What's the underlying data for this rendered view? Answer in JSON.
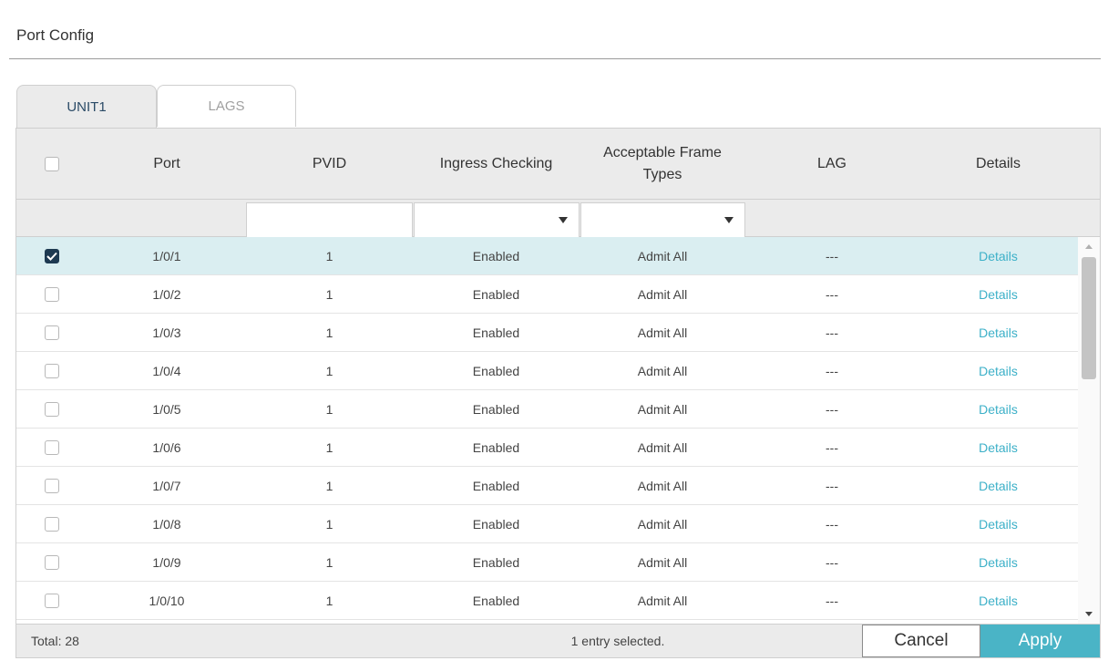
{
  "section": {
    "title": "Port Config"
  },
  "tabs": [
    {
      "label": "UNIT1",
      "active": true
    },
    {
      "label": "LAGS",
      "active": false
    }
  ],
  "columns": {
    "port": "Port",
    "pvid": "PVID",
    "ingress": "Ingress Checking",
    "frame_types": "Acceptable Frame Types",
    "lag": "LAG",
    "details": "Details"
  },
  "rows": [
    {
      "checked": true,
      "port": "1/0/1",
      "pvid": "1",
      "ingress": "Enabled",
      "frame_types": "Admit All",
      "lag": "---",
      "details": "Details"
    },
    {
      "checked": false,
      "port": "1/0/2",
      "pvid": "1",
      "ingress": "Enabled",
      "frame_types": "Admit All",
      "lag": "---",
      "details": "Details"
    },
    {
      "checked": false,
      "port": "1/0/3",
      "pvid": "1",
      "ingress": "Enabled",
      "frame_types": "Admit All",
      "lag": "---",
      "details": "Details"
    },
    {
      "checked": false,
      "port": "1/0/4",
      "pvid": "1",
      "ingress": "Enabled",
      "frame_types": "Admit All",
      "lag": "---",
      "details": "Details"
    },
    {
      "checked": false,
      "port": "1/0/5",
      "pvid": "1",
      "ingress": "Enabled",
      "frame_types": "Admit All",
      "lag": "---",
      "details": "Details"
    },
    {
      "checked": false,
      "port": "1/0/6",
      "pvid": "1",
      "ingress": "Enabled",
      "frame_types": "Admit All",
      "lag": "---",
      "details": "Details"
    },
    {
      "checked": false,
      "port": "1/0/7",
      "pvid": "1",
      "ingress": "Enabled",
      "frame_types": "Admit All",
      "lag": "---",
      "details": "Details"
    },
    {
      "checked": false,
      "port": "1/0/8",
      "pvid": "1",
      "ingress": "Enabled",
      "frame_types": "Admit All",
      "lag": "---",
      "details": "Details"
    },
    {
      "checked": false,
      "port": "1/0/9",
      "pvid": "1",
      "ingress": "Enabled",
      "frame_types": "Admit All",
      "lag": "---",
      "details": "Details"
    },
    {
      "checked": false,
      "port": "1/0/10",
      "pvid": "1",
      "ingress": "Enabled",
      "frame_types": "Admit All",
      "lag": "---",
      "details": "Details"
    }
  ],
  "footer": {
    "total": "Total: 28",
    "selected": "1 entry selected.",
    "cancel_label": "Cancel",
    "apply_label": "Apply"
  },
  "colors": {
    "accent": "#4ab4c6",
    "link": "#3cb0c8",
    "selected_row": "#daeef1",
    "checkbox_checked": "#1e3a52"
  }
}
